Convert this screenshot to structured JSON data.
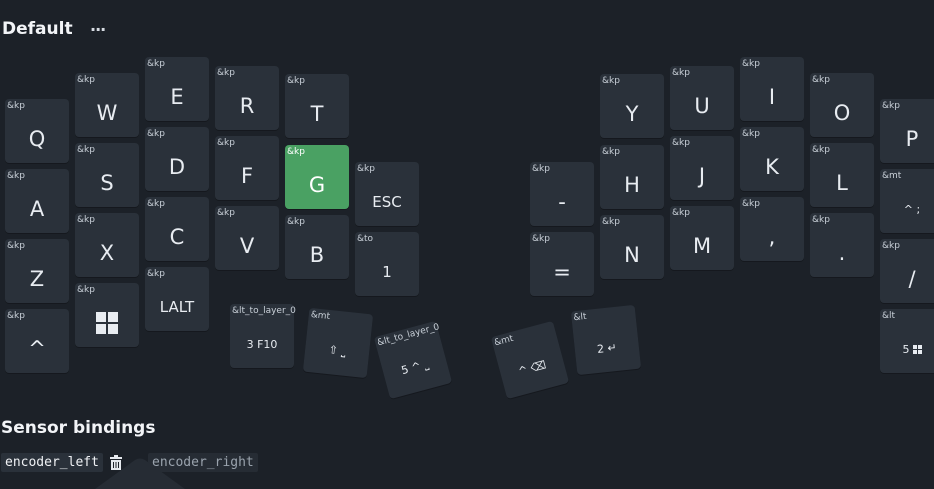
{
  "layer": {
    "title": "Default",
    "menu_label": "···"
  },
  "keys": [
    {
      "id": "q",
      "binding": "&kp",
      "legend": "Q"
    },
    {
      "id": "w",
      "binding": "&kp",
      "legend": "W"
    },
    {
      "id": "e",
      "binding": "&kp",
      "legend": "E"
    },
    {
      "id": "r",
      "binding": "&kp",
      "legend": "R"
    },
    {
      "id": "t",
      "binding": "&kp",
      "legend": "T"
    },
    {
      "id": "a",
      "binding": "&kp",
      "legend": "A"
    },
    {
      "id": "s",
      "binding": "&kp",
      "legend": "S"
    },
    {
      "id": "d",
      "binding": "&kp",
      "legend": "D"
    },
    {
      "id": "f",
      "binding": "&kp",
      "legend": "F"
    },
    {
      "id": "g",
      "binding": "&kp",
      "legend": "G"
    },
    {
      "id": "esc",
      "binding": "&kp",
      "legend": "ESC"
    },
    {
      "id": "z",
      "binding": "&kp",
      "legend": "Z"
    },
    {
      "id": "x",
      "binding": "&kp",
      "legend": "X"
    },
    {
      "id": "c",
      "binding": "&kp",
      "legend": "C"
    },
    {
      "id": "v",
      "binding": "&kp",
      "legend": "V"
    },
    {
      "id": "b",
      "binding": "&kp",
      "legend": "B"
    },
    {
      "id": "to1",
      "binding": "&to",
      "legend": "1"
    },
    {
      "id": "caret-left",
      "binding": "&kp",
      "legend": "^"
    },
    {
      "id": "win",
      "binding": "&kp",
      "legend": "",
      "icon": "windows-icon"
    },
    {
      "id": "lalt",
      "binding": "&kp",
      "legend": "LALT"
    },
    {
      "id": "lt-f10",
      "binding": "&lt_to_layer_0",
      "legend": "3 F10"
    },
    {
      "id": "mt-shift-space",
      "binding": "&mt",
      "legend": "⇧ ⎵"
    },
    {
      "id": "lt-5-space",
      "binding": "&lt_to_layer_0",
      "legend": "5 ^ ⎵"
    },
    {
      "id": "mt-backspace",
      "binding": "&mt",
      "legend": "^ ⌫"
    },
    {
      "id": "lt-enter",
      "binding": "&lt",
      "legend": "2 ↵"
    },
    {
      "id": "minus",
      "binding": "&kp",
      "legend": "-"
    },
    {
      "id": "equal",
      "binding": "&kp",
      "legend": "="
    },
    {
      "id": "y",
      "binding": "&kp",
      "legend": "Y"
    },
    {
      "id": "u",
      "binding": "&kp",
      "legend": "U"
    },
    {
      "id": "i",
      "binding": "&kp",
      "legend": "I"
    },
    {
      "id": "o",
      "binding": "&kp",
      "legend": "O"
    },
    {
      "id": "p",
      "binding": "&kp",
      "legend": "P"
    },
    {
      "id": "h",
      "binding": "&kp",
      "legend": "H"
    },
    {
      "id": "j",
      "binding": "&kp",
      "legend": "J"
    },
    {
      "id": "k",
      "binding": "&kp",
      "legend": "K"
    },
    {
      "id": "l",
      "binding": "&kp",
      "legend": "L"
    },
    {
      "id": "mt-semicolon",
      "binding": "&mt",
      "legend": "^ ;"
    },
    {
      "id": "n",
      "binding": "&kp",
      "legend": "N"
    },
    {
      "id": "m",
      "binding": "&kp",
      "legend": "M"
    },
    {
      "id": "comma",
      "binding": "&kp",
      "legend": ","
    },
    {
      "id": "dot",
      "binding": "&kp",
      "legend": "."
    },
    {
      "id": "slash",
      "binding": "&kp",
      "legend": "/"
    },
    {
      "id": "lt-5-win",
      "binding": "&lt",
      "legend": "5"
    }
  ],
  "sensors": {
    "title": "Sensor bindings",
    "tabs": [
      "encoder_left",
      "encoder_right"
    ],
    "selected": "encoder_left"
  },
  "colors": {
    "background": "#1c2128",
    "key": "#2a313a",
    "active_key": "#4aa163"
  }
}
